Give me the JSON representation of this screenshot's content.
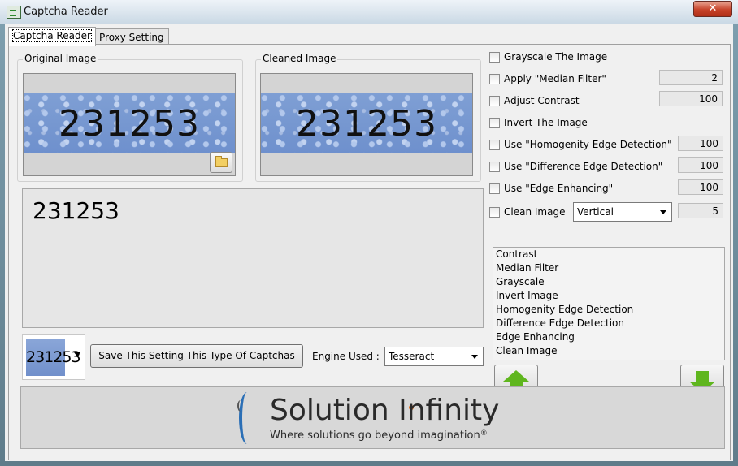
{
  "window": {
    "title": "Captcha Reader",
    "close_glyph": "✕"
  },
  "tabs": [
    {
      "label": "Captcha Reader",
      "active": true
    },
    {
      "label": "Proxy Setting",
      "active": false
    }
  ],
  "original_image": {
    "legend": "Original Image",
    "captcha_text": "231253"
  },
  "cleaned_image": {
    "legend": "Cleaned Image",
    "captcha_text": "231253"
  },
  "result": {
    "text": "231253"
  },
  "thumbnail": {
    "text": "231253"
  },
  "save_button": {
    "label": "Save This Setting This Type Of Captchas"
  },
  "engine": {
    "label": "Engine Used :",
    "value": "Tesseract"
  },
  "options": {
    "grayscale": {
      "label": "Grayscale The Image",
      "checked": false
    },
    "median": {
      "label": "Apply \"Median Filter\"",
      "checked": false,
      "value": "2"
    },
    "contrast": {
      "label": "Adjust Contrast",
      "checked": false,
      "value": "100"
    },
    "invert": {
      "label": "Invert The Image",
      "checked": false
    },
    "homogenity": {
      "label": "Use \"Homogenity Edge Detection\"",
      "checked": false,
      "value": "100"
    },
    "difference": {
      "label": "Use \"Difference Edge Detection\"",
      "checked": false,
      "value": "100"
    },
    "enhancing": {
      "label": "Use \"Edge Enhancing\"",
      "checked": false,
      "value": "100"
    },
    "clean": {
      "label": "Clean Image",
      "checked": false,
      "direction": "Vertical",
      "value": "5"
    }
  },
  "filter_order": [
    "Contrast",
    "Median Filter",
    "Grayscale",
    "Invert Image",
    "Homogenity Edge Detection",
    "Difference Edge Detection",
    "Edge Enhancing",
    "Clean Image"
  ],
  "banner": {
    "brand": "Solution Infinity",
    "tagline": "Where solutions go beyond imagination",
    "registered": "®"
  },
  "colors": {
    "arrow": "#5fb61e",
    "brand_blue": "#2b6fb6",
    "brand_orange": "#e06a18"
  }
}
